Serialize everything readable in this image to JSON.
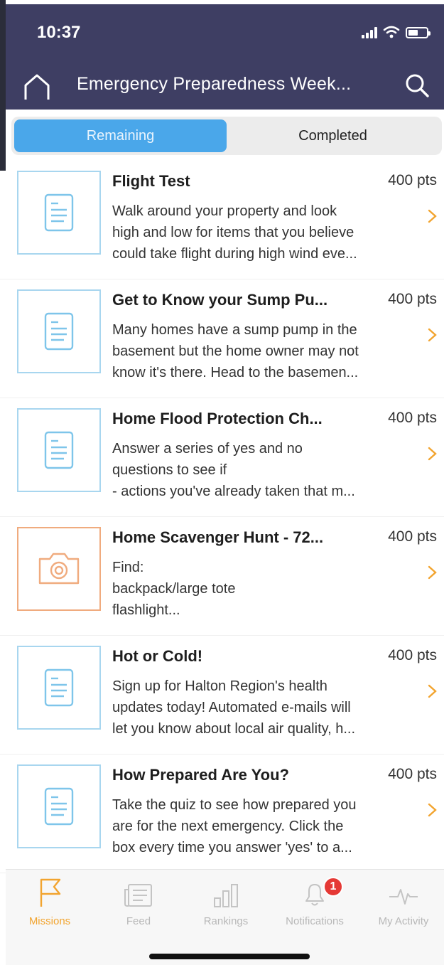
{
  "status_bar": {
    "time": "10:37"
  },
  "header": {
    "title": "Emergency Preparedness Week..."
  },
  "segments": {
    "remaining": "Remaining",
    "completed": "Completed"
  },
  "missions": [
    {
      "icon": "document-icon",
      "title": "Flight Test",
      "points": "400 pts",
      "description": "Walk around your property and look\nhigh and low for items that you believe\ncould take flight during high wind eve..."
    },
    {
      "icon": "document-icon",
      "title": "Get to Know your Sump Pu...",
      "points": "400 pts",
      "description": "Many homes have a sump pump in the\nbasement but the home owner may not\nknow it's there. Head to the basemen..."
    },
    {
      "icon": "document-icon",
      "title": "Home Flood Protection Ch...",
      "points": "400 pts",
      "description": "Answer a series of yes and no\nquestions to see if\n - actions you've already taken that m..."
    },
    {
      "icon": "camera-icon",
      "title": "Home Scavenger Hunt - 72...",
      "points": "400 pts",
      "description": "Find:\nbackpack/large tote\nflashlight..."
    },
    {
      "icon": "document-icon",
      "title": "Hot or Cold!",
      "points": "400 pts",
      "description": "Sign up for Halton Region's health\nupdates today! Automated e-mails will\nlet you know about local air quality, h..."
    },
    {
      "icon": "document-icon",
      "title": "How Prepared Are You?",
      "points": "400 pts",
      "description": "Take the quiz to see how prepared you\nare for the next emergency.  Click the\nbox every time you answer 'yes' to a..."
    }
  ],
  "tabbar": {
    "missions": "Missions",
    "feed": "Feed",
    "rankings": "Rankings",
    "notifications": "Notifications",
    "notifications_badge": "1",
    "activity": "My Activity"
  },
  "colors": {
    "header_bg": "#3e3e63",
    "segment_active": "#4aa7ea",
    "doc_icon": "#7ec5ea",
    "camera_icon": "#f0ab7e",
    "chevron": "#f2a42f",
    "tab_active": "#f2a42f",
    "badge": "#e53935"
  }
}
